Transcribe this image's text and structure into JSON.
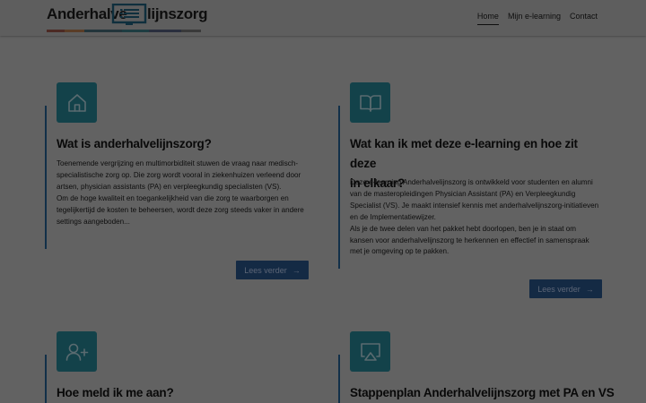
{
  "header": {
    "logo_left": "Anderhalve",
    "logo_right": "lijnszorg",
    "logo_bar_colors": [
      "#4c2a24",
      "#5a3d27",
      "#23353b",
      "#1e3d42",
      "#2a2f3e",
      "#3a3a3a"
    ],
    "nav": [
      {
        "label": "Home",
        "active": true
      },
      {
        "label": "Mijn e-learning",
        "active": false
      },
      {
        "label": "Contact",
        "active": false
      }
    ]
  },
  "cards": [
    {
      "icon": "home-icon",
      "title_lines": [
        "Wat is anderhalvelijnszorg?"
      ],
      "paragraphs": [
        "Toenemende vergrijzing en multimorbiditeit stuwen de vraag naar medisch-specialistische zorg op. Die zorg wordt vooral in ziekenhuizen verleend door artsen, physician assistants (PA) en verpleegkundig specialisten (VS).",
        "Om de hoge kwaliteit en toegankelijkheid van die zorg te waarborgen en tegelijkertijd de kosten te beheersen, wordt deze zorg steeds vaker in andere settings aangeboden..."
      ],
      "button": "Lees verder"
    },
    {
      "icon": "book-icon",
      "title_lines": [
        "Wat kan ik met deze e-learning en hoe zit deze",
        "in elkaar?"
      ],
      "paragraphs": [
        "Deze e-learning Anderhalvelijnszorg is ontwikkeld voor studenten en alumni van de masteropleidingen Physician Assistant (PA) en Verpleegkundig Specialist (VS). Je maakt intensief kennis met anderhalvelijnszorg-initiatieven en de Implementatiewijzer.",
        "Als je de twee delen van het pakket hebt doorlopen, ben je in staat om kansen voor anderhalvelijnszorg te herkennen en effectief in samenspraak met je omgeving op te pakken."
      ],
      "button": "Lees verder"
    },
    {
      "icon": "user-add-icon",
      "title_lines": [
        "Hoe meld ik me aan?"
      ]
    },
    {
      "icon": "airplay-icon",
      "title_lines": [
        "Stappenplan Anderhalvelijnszorg met PA en VS"
      ]
    }
  ],
  "colors": {
    "page_bg": "#626262",
    "icon_bg": "#13424a",
    "button_bg": "#142a44",
    "accent": "#123049"
  }
}
